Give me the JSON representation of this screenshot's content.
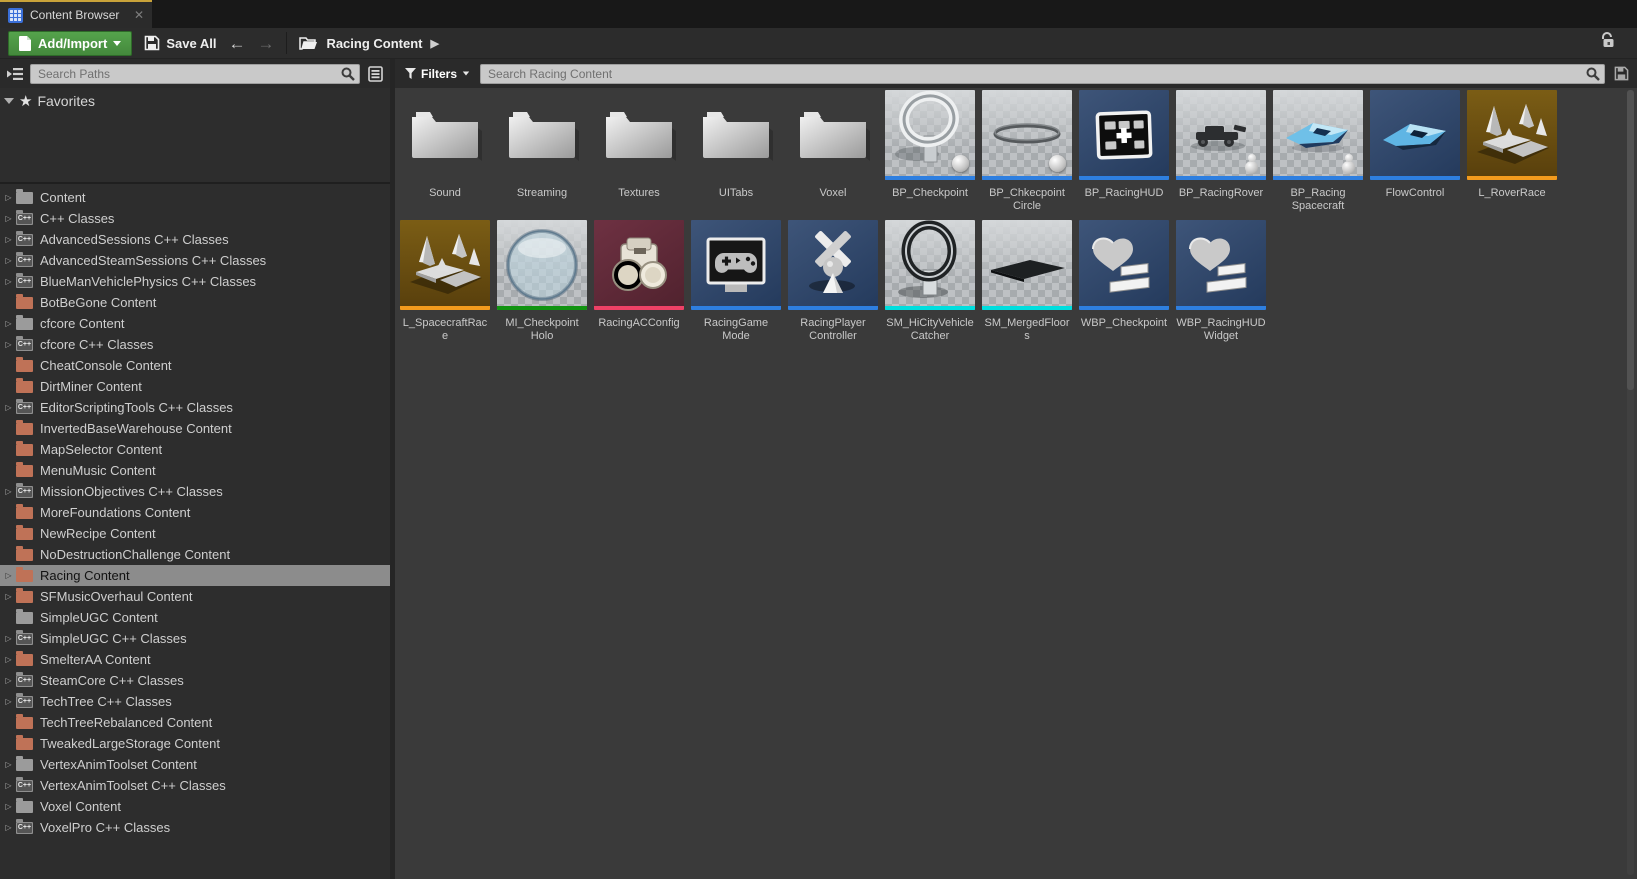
{
  "window": {
    "tab_title": "Content Browser",
    "close_glyph": "✕"
  },
  "toolbar": {
    "add_import_label": "Add/Import",
    "save_all_label": "Save All",
    "back_glyph": "←",
    "forward_glyph": "→",
    "breadcrumb_root": "Racing Content",
    "breadcrumb_next_glyph": "▶"
  },
  "left_panel": {
    "search_placeholder": "Search Paths",
    "favorites_label": "Favorites",
    "tree": [
      {
        "label": "Content",
        "icon": "gray",
        "arrow": true,
        "selected": false
      },
      {
        "label": "C++ Classes",
        "icon": "cpp",
        "arrow": true,
        "selected": false
      },
      {
        "label": "AdvancedSessions C++ Classes",
        "icon": "cpp",
        "arrow": true,
        "selected": false
      },
      {
        "label": "AdvancedSteamSessions C++ Classes",
        "icon": "cpp",
        "arrow": true,
        "selected": false
      },
      {
        "label": "BlueManVehiclePhysics C++ Classes",
        "icon": "cpp",
        "arrow": true,
        "selected": false
      },
      {
        "label": "BotBeGone Content",
        "icon": "salmon",
        "arrow": false,
        "selected": false
      },
      {
        "label": "cfcore Content",
        "icon": "gray",
        "arrow": true,
        "selected": false
      },
      {
        "label": "cfcore C++ Classes",
        "icon": "cpp",
        "arrow": true,
        "selected": false
      },
      {
        "label": "CheatConsole Content",
        "icon": "salmon",
        "arrow": false,
        "selected": false
      },
      {
        "label": "DirtMiner Content",
        "icon": "salmon",
        "arrow": false,
        "selected": false
      },
      {
        "label": "EditorScriptingTools C++ Classes",
        "icon": "cpp",
        "arrow": true,
        "selected": false
      },
      {
        "label": "InvertedBaseWarehouse Content",
        "icon": "salmon",
        "arrow": false,
        "selected": false
      },
      {
        "label": "MapSelector Content",
        "icon": "salmon",
        "arrow": false,
        "selected": false
      },
      {
        "label": "MenuMusic Content",
        "icon": "salmon",
        "arrow": false,
        "selected": false
      },
      {
        "label": "MissionObjectives C++ Classes",
        "icon": "cpp",
        "arrow": true,
        "selected": false
      },
      {
        "label": "MoreFoundations Content",
        "icon": "salmon",
        "arrow": false,
        "selected": false
      },
      {
        "label": "NewRecipe Content",
        "icon": "salmon",
        "arrow": false,
        "selected": false
      },
      {
        "label": "NoDestructionChallenge Content",
        "icon": "salmon",
        "arrow": false,
        "selected": false
      },
      {
        "label": "Racing Content",
        "icon": "salmon",
        "arrow": true,
        "selected": true
      },
      {
        "label": "SFMusicOverhaul Content",
        "icon": "salmon",
        "arrow": true,
        "selected": false
      },
      {
        "label": "SimpleUGC Content",
        "icon": "gray",
        "arrow": false,
        "selected": false
      },
      {
        "label": "SimpleUGC C++ Classes",
        "icon": "cpp",
        "arrow": true,
        "selected": false
      },
      {
        "label": "SmelterAA Content",
        "icon": "salmon",
        "arrow": true,
        "selected": false
      },
      {
        "label": "SteamCore C++ Classes",
        "icon": "cpp",
        "arrow": true,
        "selected": false
      },
      {
        "label": "TechTree C++ Classes",
        "icon": "cpp",
        "arrow": true,
        "selected": false
      },
      {
        "label": "TechTreeRebalanced Content",
        "icon": "salmon",
        "arrow": false,
        "selected": false
      },
      {
        "label": "TweakedLargeStorage Content",
        "icon": "salmon",
        "arrow": false,
        "selected": false
      },
      {
        "label": "VertexAnimToolset Content",
        "icon": "gray",
        "arrow": true,
        "selected": false
      },
      {
        "label": "VertexAnimToolset C++ Classes",
        "icon": "cpp",
        "arrow": true,
        "selected": false
      },
      {
        "label": "Voxel Content",
        "icon": "gray",
        "arrow": true,
        "selected": false
      },
      {
        "label": "VoxelPro C++ Classes",
        "icon": "cpp",
        "arrow": true,
        "selected": false
      }
    ]
  },
  "main_panel": {
    "filters_label": "Filters",
    "search_placeholder": "Search Racing Content",
    "bar_colors": {
      "blueprint": "#2e7fe0",
      "level": "#f39b1d",
      "material": "#119311",
      "data": "#ef4166",
      "mesh": "#00dede",
      "folder": ""
    },
    "assets": [
      {
        "label": "Sound",
        "type": "folder",
        "thumb": "folder"
      },
      {
        "label": "Streaming",
        "type": "folder",
        "thumb": "folder"
      },
      {
        "label": "Textures",
        "type": "folder",
        "thumb": "folder"
      },
      {
        "label": "UITabs",
        "type": "folder",
        "thumb": "folder"
      },
      {
        "label": "Voxel",
        "type": "folder",
        "thumb": "folder"
      },
      {
        "label": "BP_Checkpoint",
        "type": "blueprint",
        "thumb": "ring",
        "badge": "sphere"
      },
      {
        "label": "BP_Chkecpoint Circle",
        "type": "blueprint",
        "thumb": "circle",
        "badge": "sphere"
      },
      {
        "label": "BP_RacingHUD",
        "type": "blueprint",
        "thumb": "hud"
      },
      {
        "label": "BP_RacingRover",
        "type": "blueprint",
        "thumb": "rover",
        "badge": "snowman"
      },
      {
        "label": "BP_Racing Spacecraft",
        "type": "blueprint",
        "thumb": "craftChecker",
        "badge": "snowman"
      },
      {
        "label": "FlowControl",
        "type": "blueprint",
        "thumb": "craftNavy"
      },
      {
        "label": "L_RoverRace",
        "type": "level",
        "thumb": "cones"
      },
      {
        "label": "L_SpacecraftRace",
        "type": "level",
        "thumb": "cones"
      },
      {
        "label": "MI_Checkpoint Holo",
        "type": "material",
        "thumb": "holo"
      },
      {
        "label": "RacingACConfig",
        "type": "data",
        "thumb": "camera"
      },
      {
        "label": "RacingGame Mode",
        "type": "blueprint",
        "thumb": "gamemode"
      },
      {
        "label": "RacingPlayer Controller",
        "type": "blueprint",
        "thumb": "controller"
      },
      {
        "label": "SM_HiCityVehicle Catcher",
        "type": "mesh",
        "thumb": "ringDark"
      },
      {
        "label": "SM_MergedFloors",
        "type": "mesh",
        "thumb": "floor"
      },
      {
        "label": "WBP_Checkpoint",
        "type": "blueprint",
        "thumb": "heart"
      },
      {
        "label": "WBP_RacingHUD Widget",
        "type": "blueprint",
        "thumb": "heart"
      }
    ]
  },
  "colors": {
    "tab_accent": "#c9a33a",
    "add_button_green": "#4c9a45",
    "selection_gray": "#8c8c8c",
    "folder_salmon": "#bf7257",
    "folder_gray": "#9b9b9b",
    "navy_tile": "#2d4367",
    "olive_tile": "#6a5012",
    "maroon_tile": "#5f2a38"
  }
}
